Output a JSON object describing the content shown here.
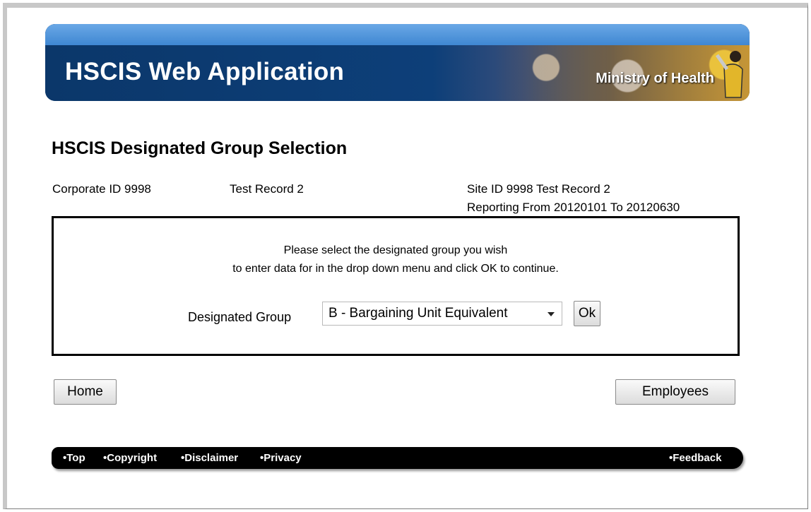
{
  "banner": {
    "title": "HSCIS Web Application",
    "ministry": "Ministry of Health"
  },
  "page": {
    "title": "HSCIS Designated Group Selection"
  },
  "info": {
    "corporate_label": "Corporate ID  9998",
    "corporate_name": "Test Record 2",
    "site": "Site ID  9998  Test Record 2",
    "reporting": "Reporting From  20120101   To  20120630"
  },
  "selection": {
    "instruction_line1": "Please select the designated group you wish",
    "instruction_line2": "to enter data for in the drop down menu and click OK to continue.",
    "group_label": "Designated Group",
    "group_selected": "B - Bargaining Unit Equivalent",
    "ok_label": "Ok"
  },
  "nav": {
    "home_label": "Home",
    "employees_label": "Employees"
  },
  "footer": {
    "top": "•Top",
    "copyright": "•Copyright",
    "disclaimer": "•Disclaimer",
    "privacy": "•Privacy",
    "feedback": "•Feedback"
  },
  "colors": {
    "banner_blue": "#0b376a",
    "banner_top": "#4b93dc",
    "footer_bg": "#000000"
  }
}
